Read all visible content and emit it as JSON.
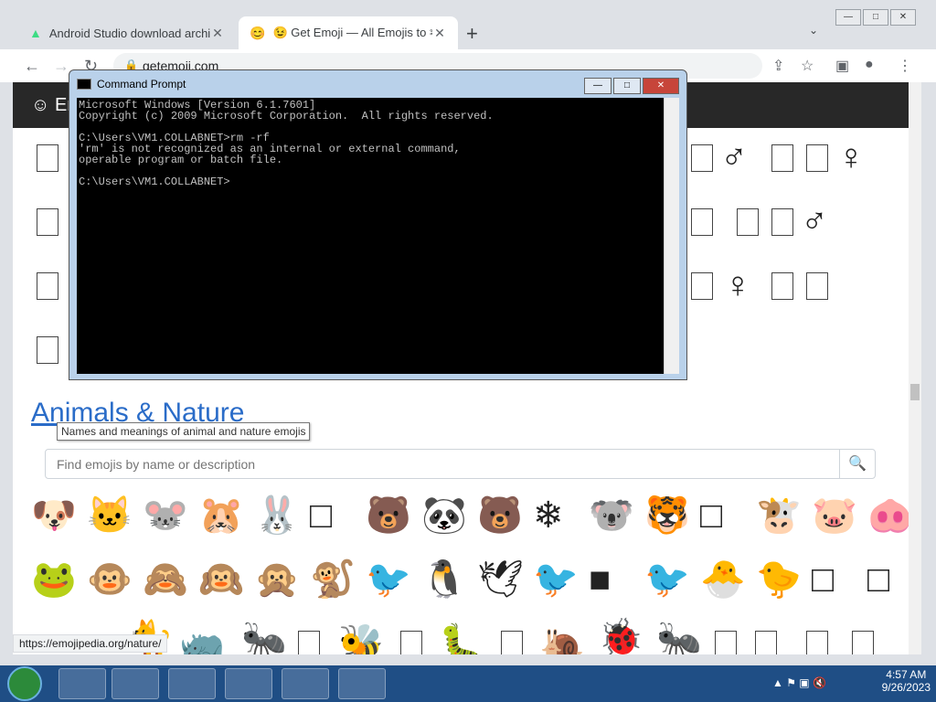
{
  "browser": {
    "tabs": [
      {
        "title": "Android Studio download archiv",
        "close": "✕"
      },
      {
        "title": "😉 Get Emoji — All Emojis to ✂ C",
        "close": "✕"
      }
    ],
    "new_tab": "+",
    "url": "getemoji.com",
    "status_url": "https://emojipedia.org/nature/"
  },
  "site": {
    "brand": "☺ Er",
    "section_title": "Animals & Nature",
    "section_tooltip": "Names and meanings of animal and nature emojis",
    "search_placeholder": "Find emojis by name or description"
  },
  "cmd": {
    "title": "Command Prompt",
    "lines": [
      "Microsoft Windows [Version 6.1.7601]",
      "Copyright (c) 2009 Microsoft Corporation.  All rights reserved.",
      "",
      "C:\\Users\\VM1.COLLABNET>rm -rf",
      "'rm' is not recognized as an internal or external command,",
      "operable program or batch file.",
      "",
      "C:\\Users\\VM1.COLLABNET>"
    ]
  },
  "emojis": {
    "row1": [
      "🐶",
      "🐱",
      "🐭",
      "🐹",
      "🐰",
      "□",
      "🐻",
      "🐼",
      "🐻",
      "❄",
      "🐨",
      "🐯",
      "□",
      "🐮",
      "🐷",
      "🐽"
    ],
    "row2": [
      "🐸",
      "🐵",
      "🙈",
      "🙉",
      "🙊",
      "🐒",
      "🐦",
      "🐧",
      "🕊",
      "🐦",
      "■",
      "🐦",
      "🐣",
      "🐤",
      "□",
      "□"
    ]
  },
  "taskbar": {
    "time": "4:57 AM",
    "date": "9/26/2023"
  }
}
